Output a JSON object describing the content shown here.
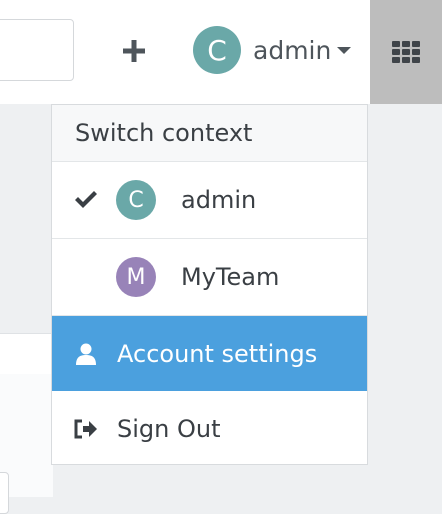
{
  "header": {
    "user": {
      "name": "admin",
      "initial": "C",
      "avatar_color": "#6aa8a8"
    },
    "add_icon": "plus-icon",
    "apps_icon": "grid-icon"
  },
  "context_menu": {
    "title": "Switch context",
    "contexts": [
      {
        "initial": "C",
        "label": "admin",
        "color": "#6aa8a8",
        "selected": true
      },
      {
        "initial": "M",
        "label": "MyTeam",
        "color": "#9883b8",
        "selected": false
      }
    ],
    "actions": [
      {
        "icon": "user-icon",
        "label": "Account settings",
        "highlighted": true
      },
      {
        "icon": "sign-out-icon",
        "label": "Sign Out",
        "highlighted": false
      }
    ]
  },
  "colors": {
    "highlight": "#4ba0de",
    "apps_button_bg": "#bdbdbd"
  }
}
